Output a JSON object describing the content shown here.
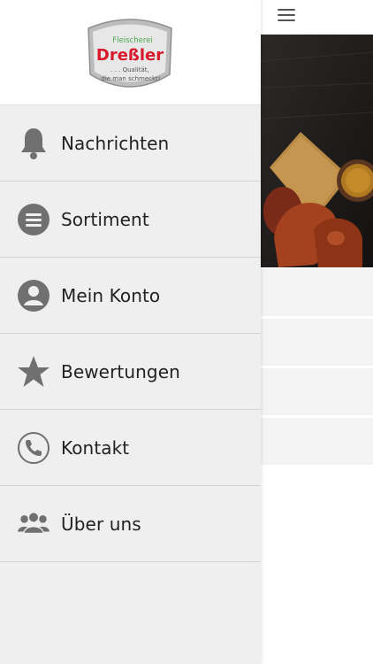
{
  "brand": {
    "line1": "Fleischerei",
    "name": "Dreßler",
    "tagline1": ". . . Qualität,",
    "tagline2": "die man schmeckt!"
  },
  "menu": {
    "items": [
      {
        "label": "Nachrichten",
        "icon": "bell-icon"
      },
      {
        "label": "Sortiment",
        "icon": "list-icon"
      },
      {
        "label": "Mein Konto",
        "icon": "user-icon"
      },
      {
        "label": "Bewertungen",
        "icon": "star-icon"
      },
      {
        "label": "Kontakt",
        "icon": "phone-icon"
      },
      {
        "label": "Über uns",
        "icon": "group-icon"
      }
    ]
  },
  "colors": {
    "drawer_bg": "#efefef",
    "icon": "#707070",
    "brand_red": "#d7192b",
    "brand_green": "#4aa84a"
  }
}
